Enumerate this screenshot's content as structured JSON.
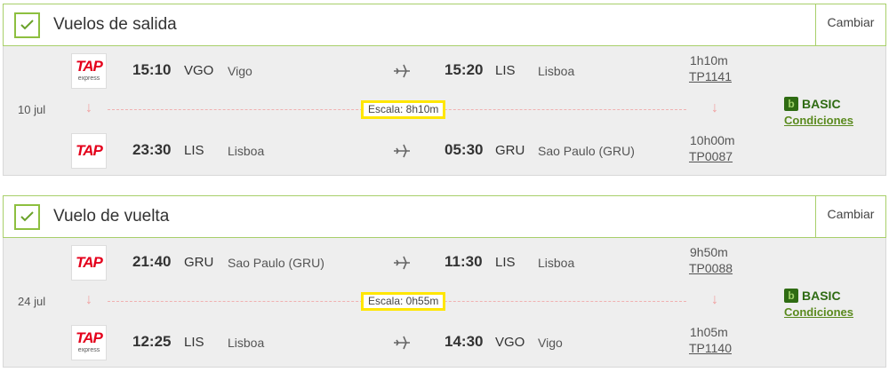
{
  "outbound": {
    "title": "Vuelos de salida",
    "change_label": "Cambiar",
    "date": "10 jul",
    "layover": "Escala: 8h10m",
    "fare": {
      "name": "BASIC",
      "conditions": "Condiciones",
      "icon": "b"
    },
    "legs": [
      {
        "logo": "TAP",
        "logo_sub": "express",
        "dep_time": "15:10",
        "dep_code": "VGO",
        "dep_city": "Vigo",
        "arr_time": "15:20",
        "arr_code": "LIS",
        "arr_city": "Lisboa",
        "duration": "1h10m",
        "flight": "TP1141"
      },
      {
        "logo": "TAP",
        "logo_sub": "",
        "dep_time": "23:30",
        "dep_code": "LIS",
        "dep_city": "Lisboa",
        "arr_time": "05:30",
        "arr_code": "GRU",
        "arr_city": "Sao Paulo (GRU)",
        "duration": "10h00m",
        "flight": "TP0087"
      }
    ]
  },
  "return": {
    "title": "Vuelo de vuelta",
    "change_label": "Cambiar",
    "date": "24 jul",
    "layover": "Escala: 0h55m",
    "fare": {
      "name": "BASIC",
      "conditions": "Condiciones",
      "icon": "b"
    },
    "legs": [
      {
        "logo": "TAP",
        "logo_sub": "",
        "dep_time": "21:40",
        "dep_code": "GRU",
        "dep_city": "Sao Paulo (GRU)",
        "arr_time": "11:30",
        "arr_code": "LIS",
        "arr_city": "Lisboa",
        "duration": "9h50m",
        "flight": "TP0088"
      },
      {
        "logo": "TAP",
        "logo_sub": "express",
        "dep_time": "12:25",
        "dep_code": "LIS",
        "dep_city": "Lisboa",
        "arr_time": "14:30",
        "arr_code": "VGO",
        "arr_city": "Vigo",
        "duration": "1h05m",
        "flight": "TP1140"
      }
    ]
  },
  "icons": {
    "check": "check-icon",
    "plane": "plane-icon",
    "arrow": "down-arrow-icon"
  },
  "colors": {
    "accent_green": "#8dbf3f",
    "fare_green": "#2e6b12",
    "highlight": "#ffe600",
    "tap_red": "#e4001b"
  }
}
